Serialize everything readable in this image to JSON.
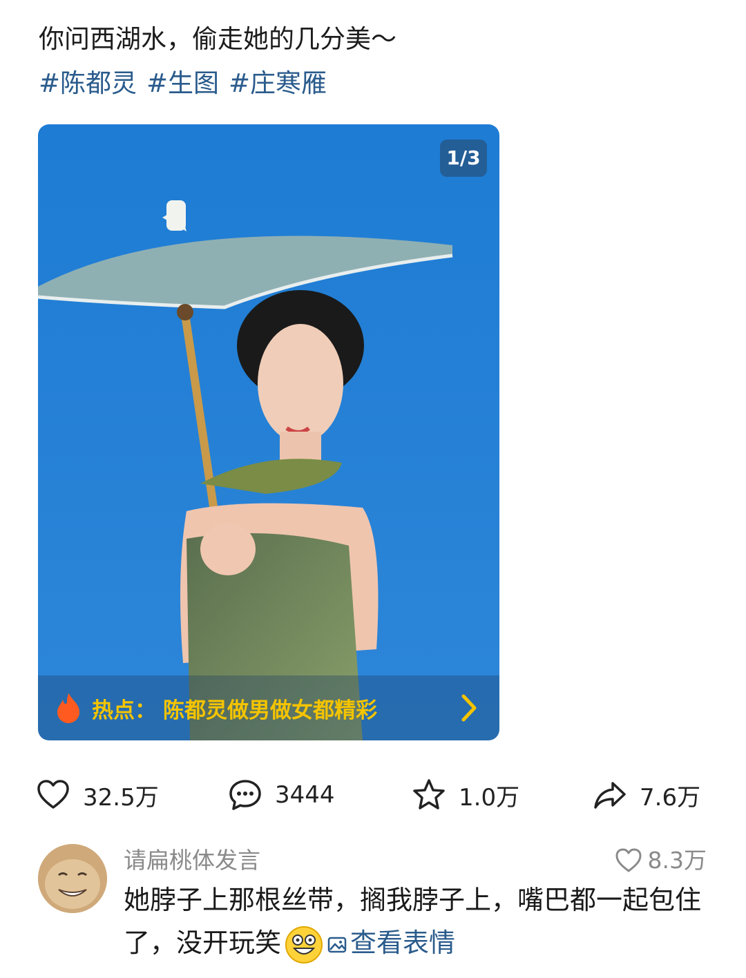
{
  "post": {
    "text": "你问西湖水，偷走她的几分美～",
    "tags": [
      "#陈都灵",
      "#生图",
      "#庄寒雁"
    ]
  },
  "photo": {
    "page_indicator": "1/3",
    "hot_label": "热点：",
    "hot_title": "陈都灵做男做女都精彩"
  },
  "actions": {
    "likes": "32.5万",
    "comments": "3444",
    "favorites": "1.0万",
    "shares": "7.6万"
  },
  "comment": {
    "username": "请扁桃体发言",
    "likes": "8.3万",
    "text": "她脖子上那根丝带，搁我脖子上，嘴巴都一起包住了，没开玩笑",
    "view_emoji": "查看表情"
  },
  "colors": {
    "link": "#2a5b8c",
    "hot": "#f5c400",
    "sky": "#1f7fd6"
  }
}
